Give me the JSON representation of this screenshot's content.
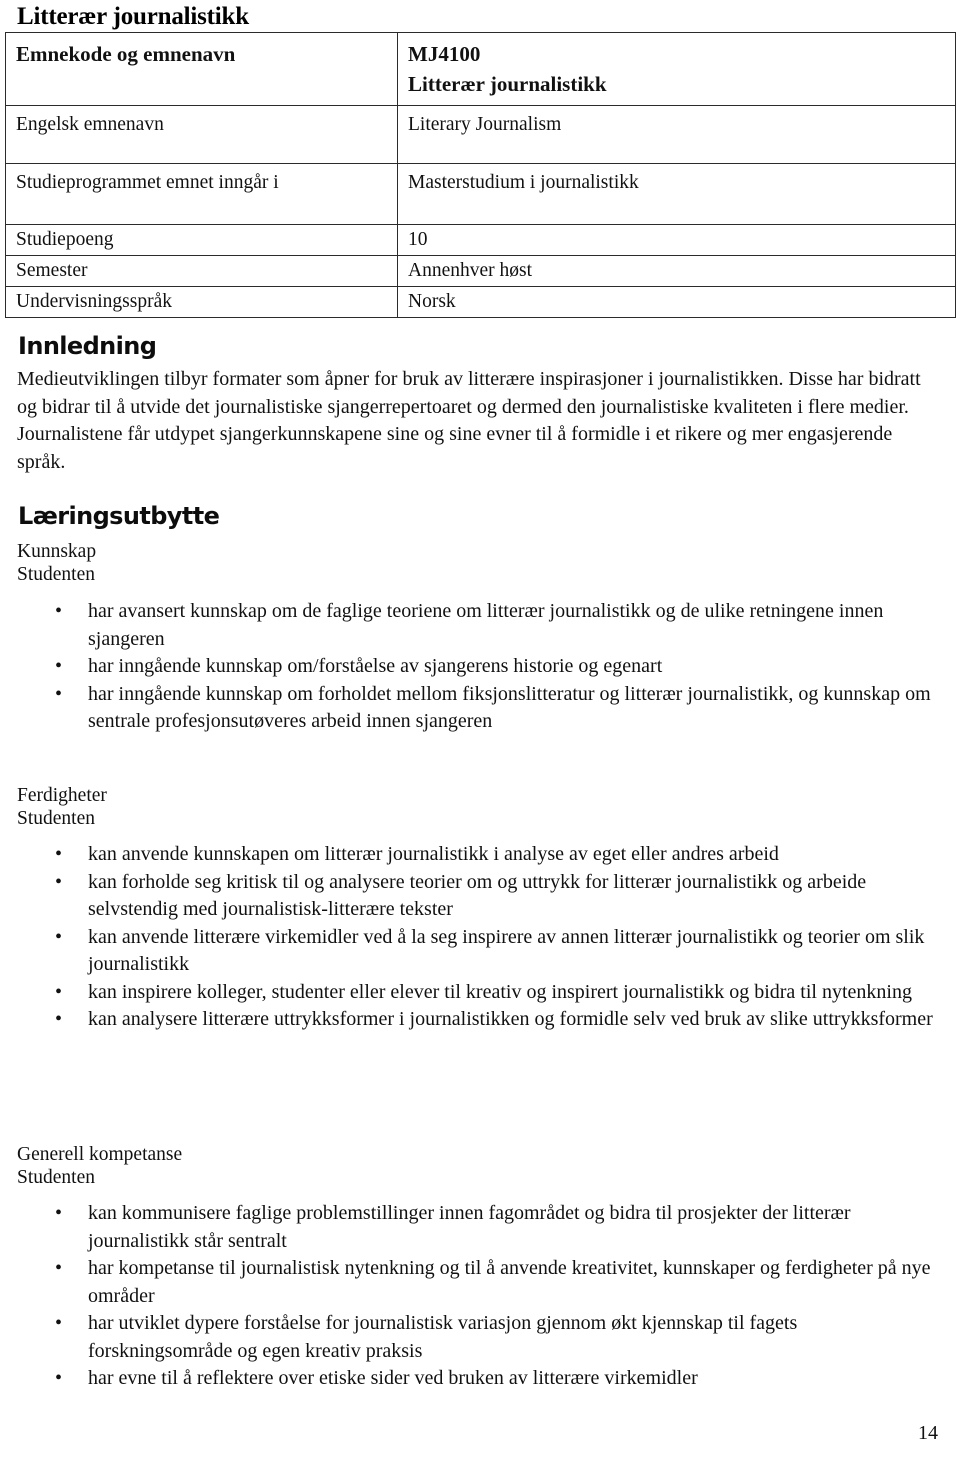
{
  "document": {
    "title": "Litterær journalistikk",
    "page_number": "14"
  },
  "info_table": {
    "rows": [
      {
        "label": "Emnekode og emnenavn",
        "value_line1": "MJ4100",
        "value_line2": "Litterær journalistikk"
      },
      {
        "label": "Engelsk emnenavn",
        "value": "Literary Journalism"
      },
      {
        "label": "Studieprogrammet emnet inngår i",
        "value": "Masterstudium i journalistikk"
      },
      {
        "label": "Studiepoeng",
        "value": "10"
      },
      {
        "label": "Semester",
        "value": "Annenhver høst"
      },
      {
        "label": "Undervisningsspråk",
        "value": "Norsk"
      }
    ]
  },
  "innledning": {
    "heading": "Innledning",
    "paragraph": "Medieutviklingen tilbyr formater som åpner for bruk av litterære inspirasjoner i journalistikken. Disse har bidratt og bidrar til å utvide det journalistiske sjangerrepertoaret og dermed den journalistiske kvaliteten i flere medier. Journalistene får utdypet sjangerkunnskapene sine og sine evner til å formidle i et rikere og mer engasjerende språk."
  },
  "laringsutbytte": {
    "heading": "Læringsutbytte",
    "groups": [
      {
        "label": "Kunnskap",
        "subject": "Studenten",
        "items": [
          "har avansert kunnskap om de faglige teoriene om litterær journalistikk og de ulike retningene innen sjangeren",
          "har inngående kunnskap om/forståelse av sjangerens historie og egenart",
          "har inngående kunnskap om forholdet mellom fiksjonslitteratur og litterær journalistikk, og kunnskap om sentrale profesjonsutøveres arbeid innen sjangeren"
        ]
      },
      {
        "label": "Ferdigheter",
        "subject": "Studenten",
        "items": [
          "kan anvende kunnskapen om litterær journalistikk i analyse av eget eller andres arbeid",
          "kan forholde seg kritisk til og analysere teorier om og uttrykk for litterær journalistikk og arbeide selvstendig med journalistisk-litterære tekster",
          "kan anvende litterære virkemidler ved å la seg inspirere av annen litterær journalistikk og teorier om slik journalistikk",
          "kan inspirere kolleger, studenter eller elever til kreativ og inspirert journalistikk og bidra til nytenkning",
          "kan analysere litterære uttrykksformer i journalistikken og formidle selv ved bruk av slike uttrykksformer"
        ]
      },
      {
        "label": "Generell kompetanse",
        "subject": "Studenten",
        "items": [
          "kan kommunisere faglige problemstillinger innen fagområdet og bidra til prosjekter der litterær journalistikk står sentralt",
          "har kompetanse til journalistisk nytenkning og til å anvende kreativitet, kunnskaper og ferdigheter på nye områder",
          "har utviklet dypere forståelse for journalistisk variasjon gjennom økt kjennskap til fagets forskningsområde og egen kreativ praksis",
          "har evne til å reflektere over etiske sider ved bruken av litterære virkemidler"
        ]
      }
    ]
  },
  "bullet_glyph": "•"
}
